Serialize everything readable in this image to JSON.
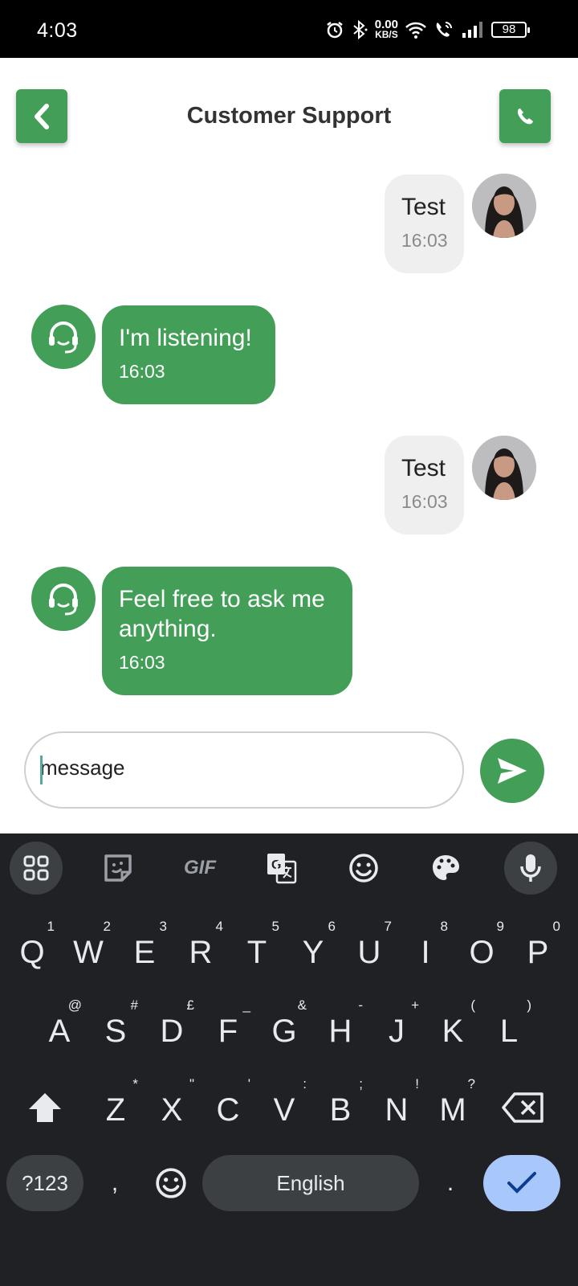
{
  "status_bar": {
    "time": "4:03",
    "net_speed_value": "0.00",
    "net_speed_unit": "KB/S",
    "battery": "98"
  },
  "header": {
    "title": "Customer Support"
  },
  "messages": [
    {
      "sender": "user",
      "text": "Test",
      "time": "16:03"
    },
    {
      "sender": "bot",
      "text": "I'm listening!",
      "time": "16:03"
    },
    {
      "sender": "user",
      "text": "Test",
      "time": "16:03"
    },
    {
      "sender": "bot",
      "text": "Feel free to ask me anything.",
      "time": "16:03"
    }
  ],
  "composer": {
    "value": "message"
  },
  "keyboard": {
    "toolbar": [
      "apps-grid-icon",
      "sticker-icon",
      "gif-icon",
      "translate-icon",
      "emoji-icon",
      "palette-icon",
      "mic-icon"
    ],
    "gif_label": "GIF",
    "row1": [
      {
        "key": "Q",
        "hint": "1"
      },
      {
        "key": "W",
        "hint": "2"
      },
      {
        "key": "E",
        "hint": "3"
      },
      {
        "key": "R",
        "hint": "4"
      },
      {
        "key": "T",
        "hint": "5"
      },
      {
        "key": "Y",
        "hint": "6"
      },
      {
        "key": "U",
        "hint": "7"
      },
      {
        "key": "I",
        "hint": "8"
      },
      {
        "key": "O",
        "hint": "9"
      },
      {
        "key": "P",
        "hint": "0"
      }
    ],
    "row2": [
      {
        "key": "A",
        "hint": "@"
      },
      {
        "key": "S",
        "hint": "#"
      },
      {
        "key": "D",
        "hint": "£"
      },
      {
        "key": "F",
        "hint": "_"
      },
      {
        "key": "G",
        "hint": "&"
      },
      {
        "key": "H",
        "hint": "-"
      },
      {
        "key": "J",
        "hint": "+"
      },
      {
        "key": "K",
        "hint": "("
      },
      {
        "key": "L",
        "hint": ")"
      }
    ],
    "row3": [
      {
        "key": "Z",
        "hint": "*"
      },
      {
        "key": "X",
        "hint": "\""
      },
      {
        "key": "C",
        "hint": "'"
      },
      {
        "key": "V",
        "hint": ":"
      },
      {
        "key": "B",
        "hint": ";"
      },
      {
        "key": "N",
        "hint": "!"
      },
      {
        "key": "M",
        "hint": "?"
      }
    ],
    "symbols_label": "?123",
    "comma": ",",
    "space_label": "English",
    "period": "."
  },
  "colors": {
    "accent": "#439f58",
    "keyboard_bg": "#202124",
    "enter_key": "#a8c7fa"
  }
}
